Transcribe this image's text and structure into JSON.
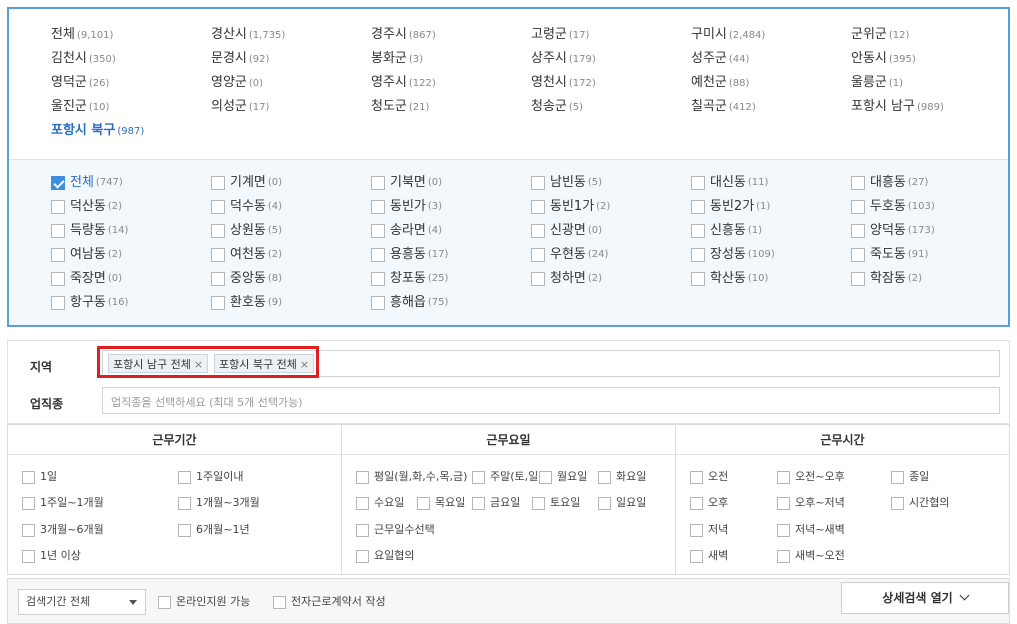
{
  "cities": [
    {
      "name": "전체",
      "count": "(9,101)"
    },
    {
      "name": "경산시",
      "count": "(1,735)"
    },
    {
      "name": "경주시",
      "count": "(867)"
    },
    {
      "name": "고령군",
      "count": "(17)"
    },
    {
      "name": "구미시",
      "count": "(2,484)"
    },
    {
      "name": "군위군",
      "count": "(12)"
    },
    {
      "name": "김천시",
      "count": "(350)"
    },
    {
      "name": "문경시",
      "count": "(92)"
    },
    {
      "name": "봉화군",
      "count": "(3)"
    },
    {
      "name": "상주시",
      "count": "(179)"
    },
    {
      "name": "성주군",
      "count": "(44)"
    },
    {
      "name": "안동시",
      "count": "(395)"
    },
    {
      "name": "영덕군",
      "count": "(26)"
    },
    {
      "name": "영양군",
      "count": "(0)"
    },
    {
      "name": "영주시",
      "count": "(122)"
    },
    {
      "name": "영천시",
      "count": "(172)"
    },
    {
      "name": "예천군",
      "count": "(88)"
    },
    {
      "name": "울릉군",
      "count": "(1)"
    },
    {
      "name": "울진군",
      "count": "(10)"
    },
    {
      "name": "의성군",
      "count": "(17)"
    },
    {
      "name": "청도군",
      "count": "(21)"
    },
    {
      "name": "청송군",
      "count": "(5)"
    },
    {
      "name": "칠곡군",
      "count": "(412)"
    },
    {
      "name": "포항시 남구",
      "count": "(989)"
    },
    {
      "name": "포항시 북구",
      "count": "(987)",
      "active": true
    }
  ],
  "dongs": [
    {
      "name": "전체",
      "count": "(747)",
      "checked": true
    },
    {
      "name": "기계면",
      "count": "(0)"
    },
    {
      "name": "기북면",
      "count": "(0)"
    },
    {
      "name": "남빈동",
      "count": "(5)"
    },
    {
      "name": "대신동",
      "count": "(11)"
    },
    {
      "name": "대흥동",
      "count": "(27)"
    },
    {
      "name": "덕산동",
      "count": "(2)"
    },
    {
      "name": "덕수동",
      "count": "(4)"
    },
    {
      "name": "동빈가",
      "count": "(3)"
    },
    {
      "name": "동빈1가",
      "count": "(2)"
    },
    {
      "name": "동빈2가",
      "count": "(1)"
    },
    {
      "name": "두호동",
      "count": "(103)"
    },
    {
      "name": "득량동",
      "count": "(14)"
    },
    {
      "name": "상원동",
      "count": "(5)"
    },
    {
      "name": "송라면",
      "count": "(4)"
    },
    {
      "name": "신광면",
      "count": "(0)"
    },
    {
      "name": "신흥동",
      "count": "(1)"
    },
    {
      "name": "양덕동",
      "count": "(173)"
    },
    {
      "name": "여남동",
      "count": "(2)"
    },
    {
      "name": "여천동",
      "count": "(2)"
    },
    {
      "name": "용흥동",
      "count": "(17)"
    },
    {
      "name": "우현동",
      "count": "(24)"
    },
    {
      "name": "장성동",
      "count": "(109)"
    },
    {
      "name": "죽도동",
      "count": "(91)"
    },
    {
      "name": "죽장면",
      "count": "(0)"
    },
    {
      "name": "중앙동",
      "count": "(8)"
    },
    {
      "name": "창포동",
      "count": "(25)"
    },
    {
      "name": "청하면",
      "count": "(2)"
    },
    {
      "name": "학산동",
      "count": "(10)"
    },
    {
      "name": "학잠동",
      "count": "(2)"
    },
    {
      "name": "항구동",
      "count": "(16)"
    },
    {
      "name": "환호동",
      "count": "(9)"
    },
    {
      "name": "흥해읍",
      "count": "(75)"
    }
  ],
  "filters": {
    "region_label": "지역",
    "region_tags": [
      "포항시 남구 전체",
      "포항시 북구 전체"
    ],
    "remove_glyph": "×",
    "job_label": "업직종",
    "job_placeholder": "업직종을 선택하세요 (최대 5개 선택가능)"
  },
  "conditions": {
    "period": {
      "title": "근무기간",
      "options": [
        "1일",
        "1주일이내",
        "1주일~1개월",
        "1개월~3개월",
        "3개월~6개월",
        "6개월~1년",
        "1년 이상"
      ]
    },
    "days": {
      "title": "근무요일",
      "options": [
        "평일(월,화,수,목,금)",
        "주말(토,일)",
        "월요일",
        "화요일",
        "수요일",
        "목요일",
        "금요일",
        "토요일",
        "일요일",
        "근무일수선택",
        "요일협의"
      ]
    },
    "hours": {
      "title": "근무시간",
      "options": [
        "오전",
        "오전~오후",
        "종일",
        "오후",
        "오후~저녁",
        "시간협의",
        "저녁",
        "저녁~새벽",
        "새벽",
        "새벽~오전"
      ]
    }
  },
  "bottom": {
    "period_select": "검색기간 전체",
    "online_apply": "온라인지원 가능",
    "e_contract": "전자근로계약서 작성",
    "detail_button": "상세검색 열기"
  }
}
